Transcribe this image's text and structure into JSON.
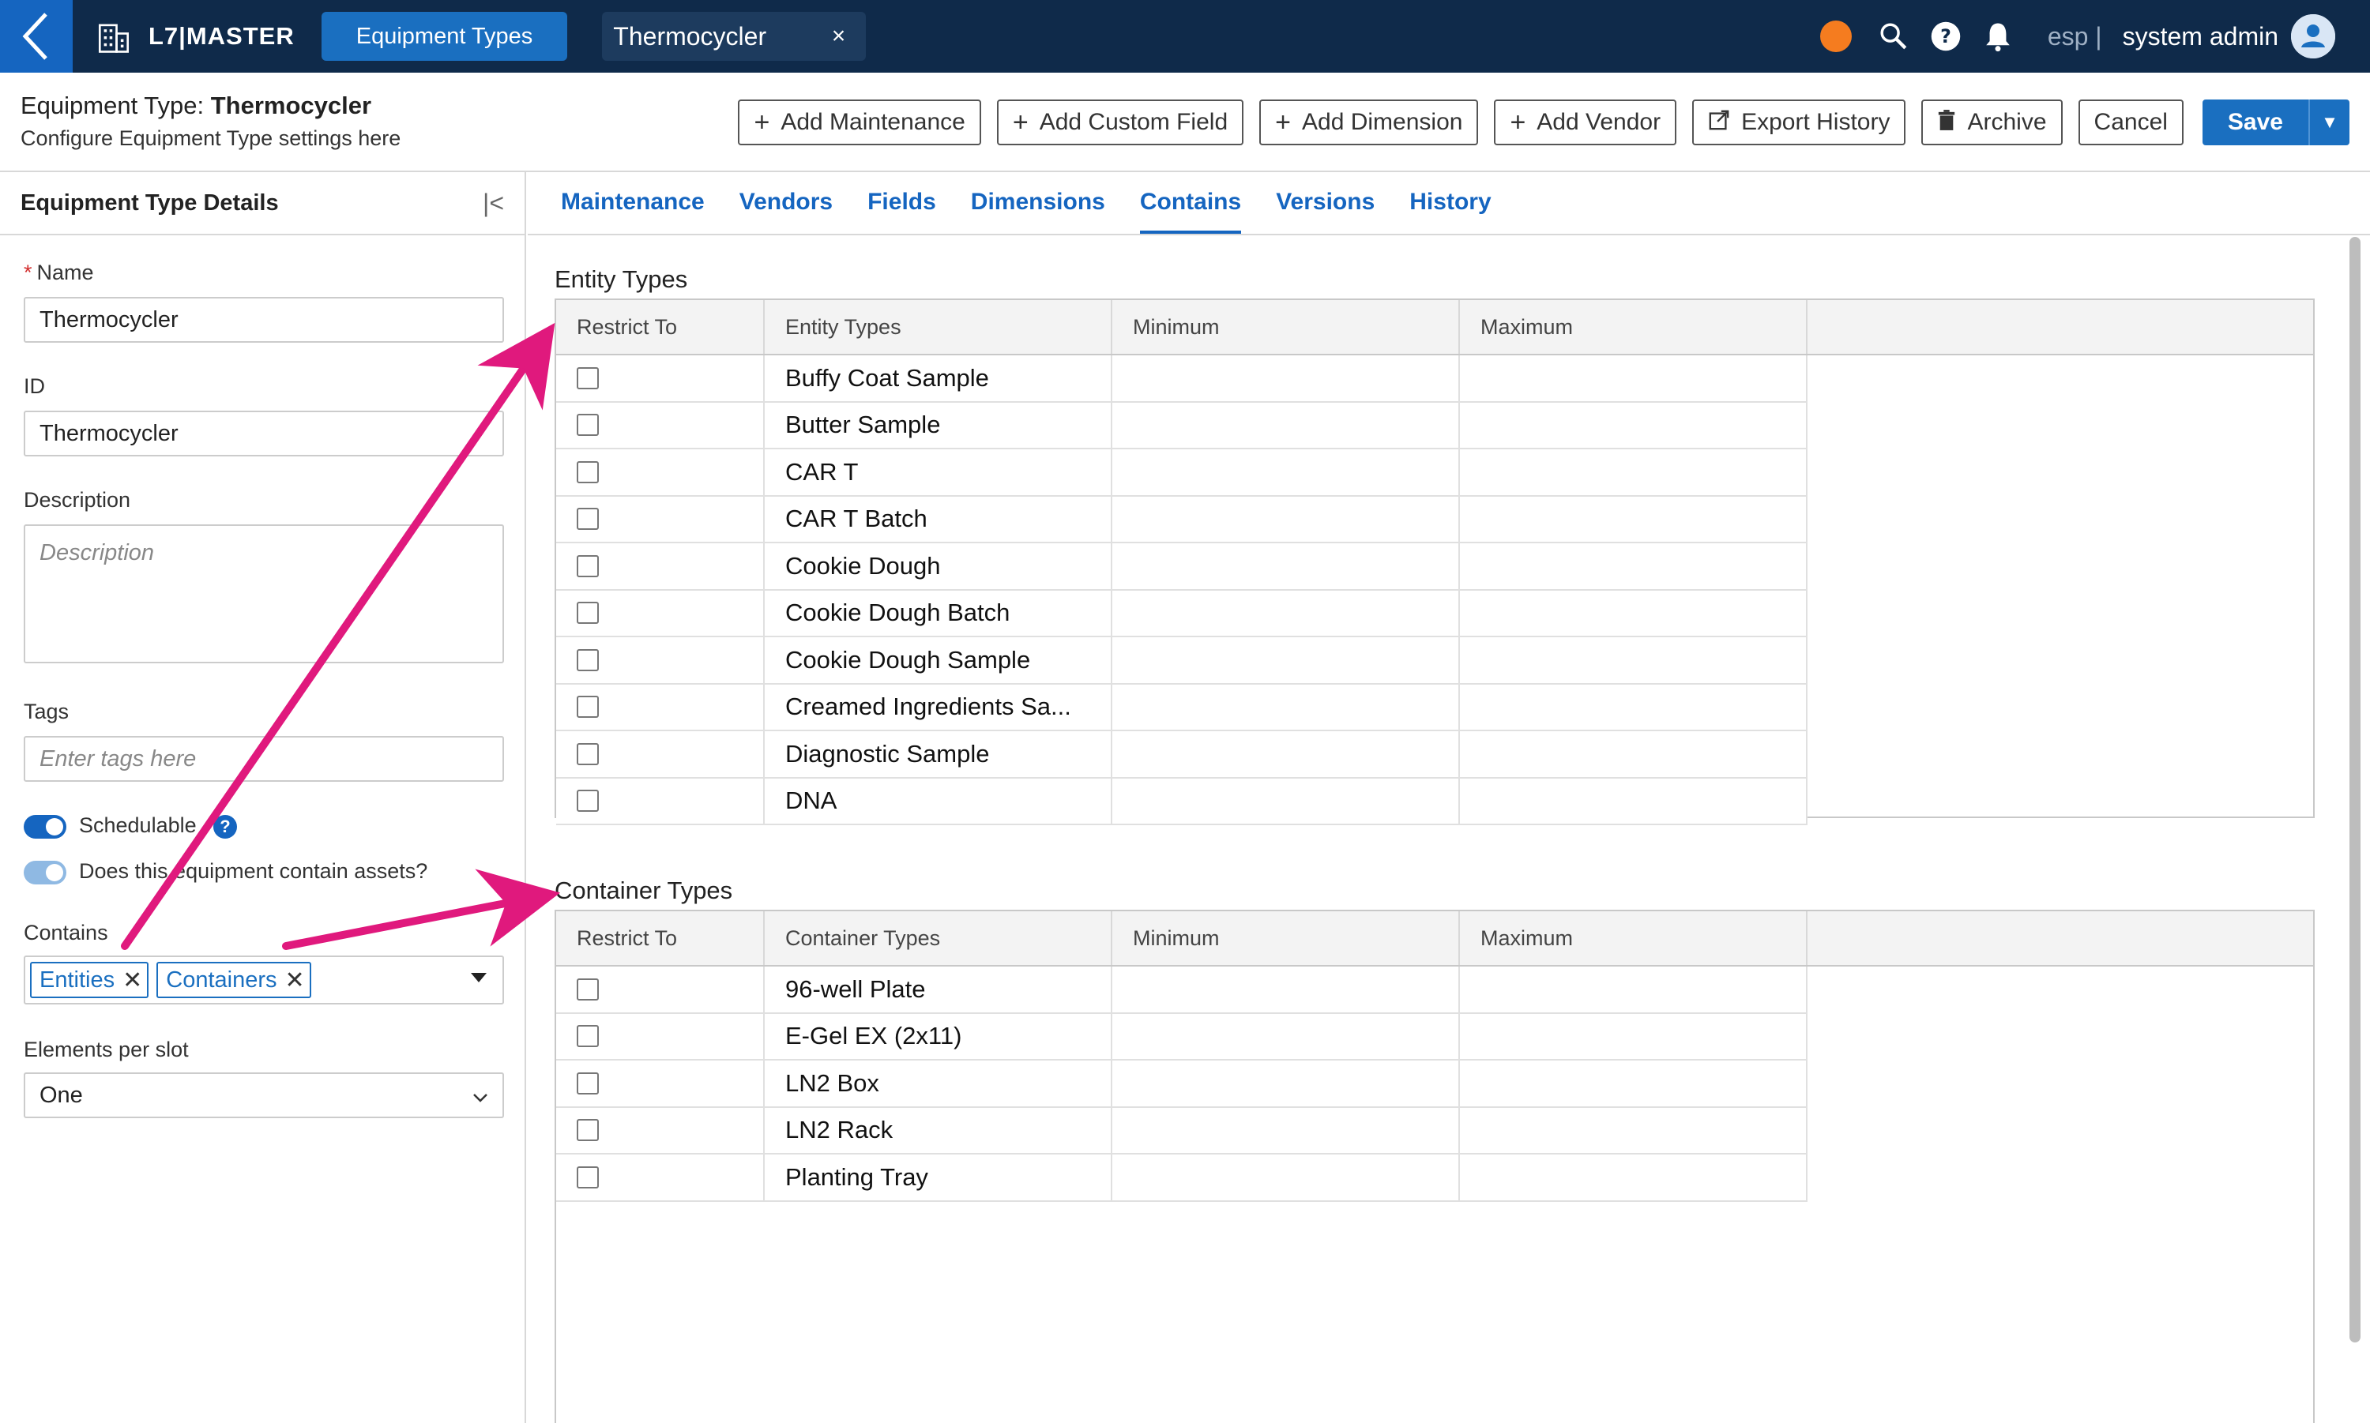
{
  "topbar": {
    "app_name": "L7|MASTER",
    "nav_tab": "Equipment Types",
    "doc_tab": "Thermocycler",
    "doc_tab_close": "×",
    "tenant": "esp |",
    "user": "system admin"
  },
  "header": {
    "title_prefix": "Equipment Type: ",
    "title_name": "Thermocycler",
    "subtitle": "Configure Equipment Type settings here",
    "buttons": {
      "add_maintenance": "Add Maintenance",
      "add_custom_field": "Add Custom Field",
      "add_dimension": "Add Dimension",
      "add_vendor": "Add Vendor",
      "export_history": "Export History",
      "archive": "Archive",
      "cancel": "Cancel",
      "save": "Save"
    }
  },
  "left": {
    "title": "Equipment Type Details",
    "name_label": "Name",
    "name_value": "Thermocycler",
    "id_label": "ID",
    "id_value": "Thermocycler",
    "description_label": "Description",
    "description_placeholder": "Description",
    "tags_label": "Tags",
    "tags_placeholder": "Enter tags here",
    "schedulable_label": "Schedulable",
    "contain_assets_label": "Does this equipment contain assets?",
    "contains_label": "Contains",
    "contains_chips": [
      "Entities",
      "Containers"
    ],
    "elements_label": "Elements per slot",
    "elements_value": "One"
  },
  "tabs": [
    "Maintenance",
    "Vendors",
    "Fields",
    "Dimensions",
    "Contains",
    "Versions",
    "History"
  ],
  "active_tab": "Contains",
  "entity_section": {
    "title": "Entity Types",
    "headers": [
      "Restrict To",
      "Entity Types",
      "Minimum",
      "Maximum"
    ],
    "rows": [
      "Buffy Coat Sample",
      "Butter Sample",
      "CAR T",
      "CAR T Batch",
      "Cookie Dough",
      "Cookie Dough Batch",
      "Cookie Dough Sample",
      "Creamed Ingredients Sa...",
      "Diagnostic Sample",
      "DNA"
    ]
  },
  "container_section": {
    "title": "Container Types",
    "headers": [
      "Restrict To",
      "Container Types",
      "Minimum",
      "Maximum"
    ],
    "rows": [
      "96-well Plate",
      "E-Gel EX (2x11)",
      "LN2 Box",
      "LN2 Rack",
      "Planting Tray"
    ]
  },
  "colors": {
    "topbar": "#0f2a4a",
    "accent": "#1a6fc0",
    "annotation_arrow": "#e0197d",
    "status_dot": "#f57c1f"
  }
}
